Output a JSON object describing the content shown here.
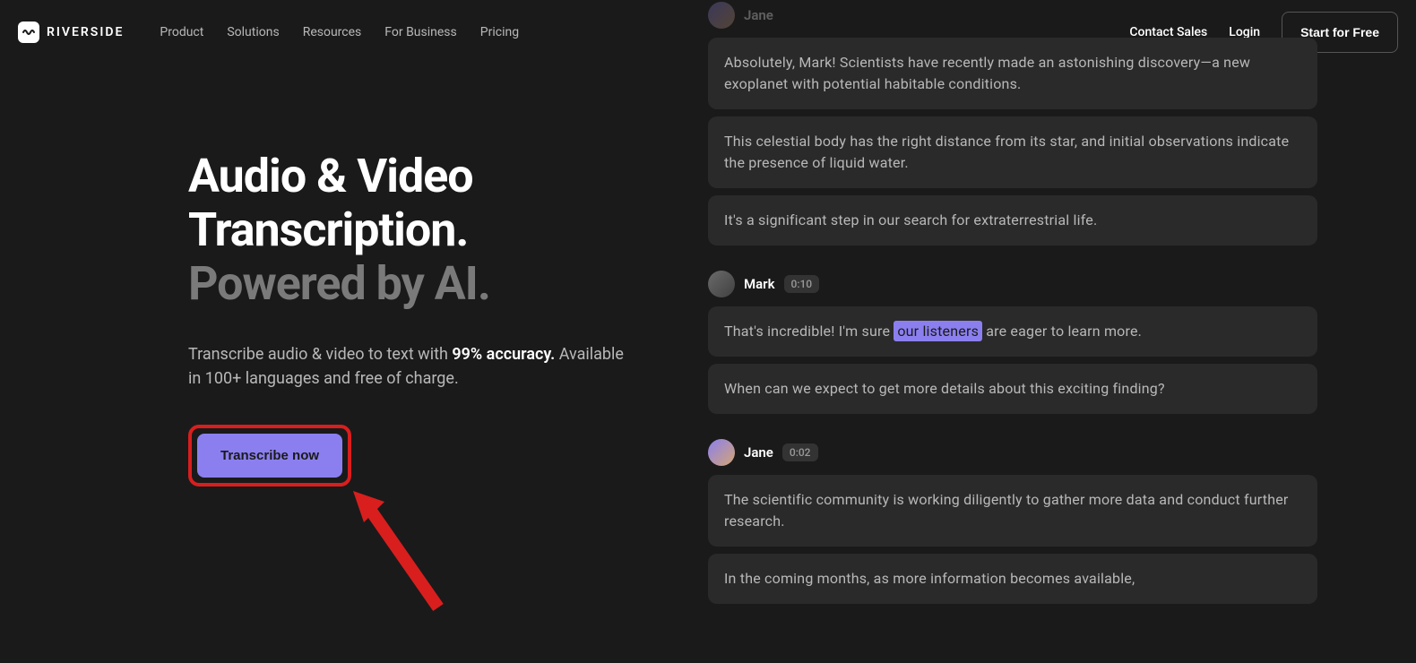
{
  "logo": {
    "text": "RIVERSIDE"
  },
  "nav": {
    "items": [
      {
        "label": "Product"
      },
      {
        "label": "Solutions"
      },
      {
        "label": "Resources"
      },
      {
        "label": "For Business"
      },
      {
        "label": "Pricing"
      }
    ]
  },
  "header_actions": {
    "contact": "Contact Sales",
    "login": "Login",
    "cta": "Start for Free"
  },
  "hero": {
    "title_line1": "Audio & Video Transcription.",
    "title_line2": "Powered by AI.",
    "subtitle_pre": "Transcribe audio & video to text with ",
    "subtitle_bold": "99% accuracy.",
    "subtitle_post": " Available in 100+ languages and free of charge.",
    "button": "Transcribe now"
  },
  "transcript": {
    "speakers": [
      {
        "name": "Jane",
        "time": "",
        "avatar_class": "jane",
        "faded": true,
        "lines": [
          "Absolutely, Mark! Scientists have recently made an astonishing discovery—a new exoplanet with potential habitable conditions.",
          "This celestial body has the right distance from its star, and initial observations indicate the presence of liquid water.",
          "It's a significant step in our search for extraterrestrial life."
        ]
      },
      {
        "name": "Mark",
        "time": "0:10",
        "avatar_class": "mark",
        "faded": false,
        "lines_with_highlight": [
          {
            "pre": "That's incredible! I'm sure ",
            "highlight": "our listeners",
            "post": " are eager to learn more."
          },
          {
            "pre": "When can we expect to get more details about this exciting finding?",
            "highlight": "",
            "post": ""
          }
        ]
      },
      {
        "name": "Jane",
        "time": "0:02",
        "avatar_class": "jane",
        "faded": false,
        "lines": [
          "The scientific community is working diligently to gather more data and conduct further research.",
          "In the coming months, as more information becomes available,"
        ]
      }
    ]
  }
}
